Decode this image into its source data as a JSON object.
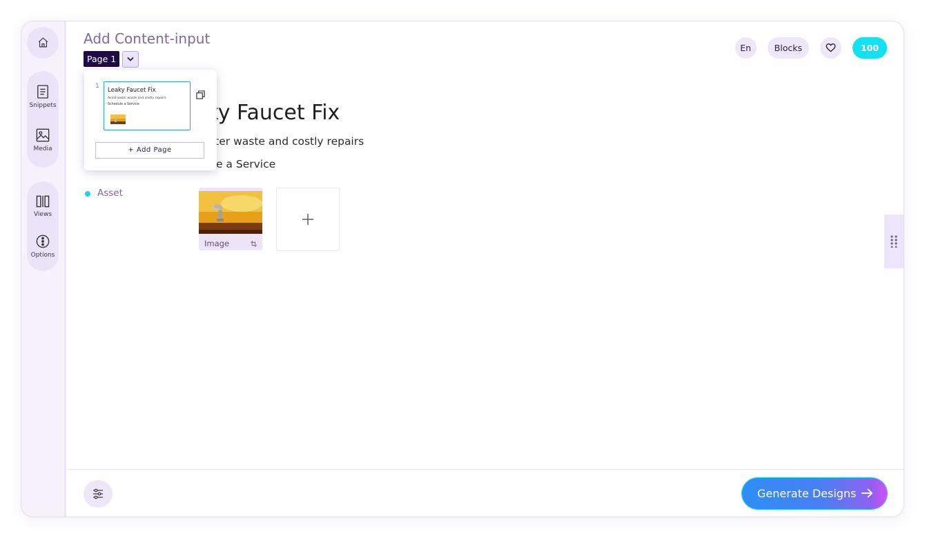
{
  "sidebar": {
    "home_label": "",
    "snippets_label": "Snippets",
    "media_label": "Media",
    "views_label": "Views",
    "options_label": "Options"
  },
  "header": {
    "title": "Add Content-input",
    "page_badge": "Page 1",
    "language": "En",
    "blocks": "Blocks",
    "credits": "100"
  },
  "content": {
    "doc_title": "Leaky Faucet Fix",
    "doc_title_visible": "aky Faucet Fix",
    "subtitle_visible": "water waste and costly repairs",
    "cta_visible": "dule a Service",
    "asset_label": "Asset",
    "asset_caption": "Image"
  },
  "pages_popover": {
    "page_number": "1",
    "thumb_title": "Leaky Faucet Fix",
    "thumb_subtitle": "Avoid water waste and costly repairs",
    "thumb_cta": "Schedule a Service",
    "add_page": "+ Add Page"
  },
  "footer": {
    "generate_label": "Generate Designs"
  },
  "colors": {
    "accent_cyan": "#14e0ef",
    "page_badge_bg": "#1e0a44",
    "title_purple": "#7d6a9c"
  }
}
